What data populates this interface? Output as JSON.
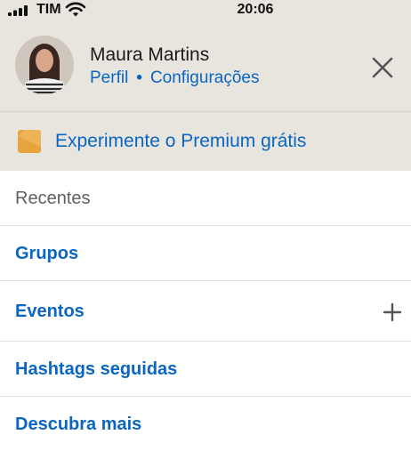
{
  "status_bar": {
    "carrier": "TIM",
    "time": "20:06",
    "signal_icon": "cellular-signal-icon",
    "wifi_icon": "wifi-icon"
  },
  "profile": {
    "name": "Maura Martins",
    "profile_link": "Perfil",
    "separator": "•",
    "settings_link": "Configurações",
    "avatar_icon": "avatar"
  },
  "close_icon": "close-icon",
  "premium": {
    "label": "Experimente o Premium grátis",
    "icon": "premium-badge-icon",
    "icon_color": "#e7a33e"
  },
  "menu": {
    "items": [
      {
        "label": "Recentes"
      },
      {
        "label": "Grupos"
      },
      {
        "label": "Eventos",
        "action_icon": "plus-icon"
      },
      {
        "label": "Hashtags seguidas"
      },
      {
        "label": "Descubra mais"
      }
    ]
  },
  "colors": {
    "accent": "#0a66c2",
    "header_bg": "#e8e4de",
    "divider": "#e0e0e0"
  }
}
